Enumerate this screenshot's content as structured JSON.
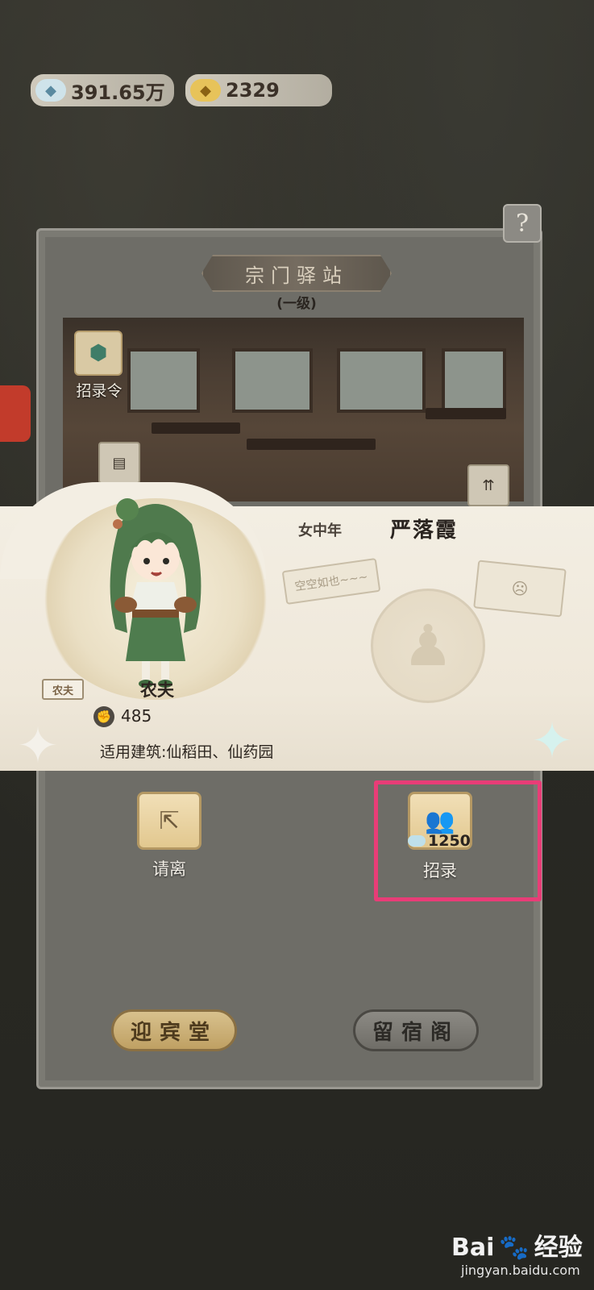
{
  "currency": {
    "silver_value": "391.65万",
    "silver_icon": "silver-ingot-icon",
    "gold_value": "2329",
    "gold_icon": "gold-ingot-icon"
  },
  "panel": {
    "help_label": "?",
    "title": "宗门驿站",
    "level": "(一级)",
    "recruit_token_label": "招录令"
  },
  "character": {
    "gender_age": "女中年",
    "name": "严落霞",
    "badge": "农夫",
    "role": "农夫",
    "power": "485",
    "buildings": "适用建筑:仙稻田、仙药园",
    "speech_bubble": "空空如也~~~"
  },
  "actions": {
    "dismiss_label": "请离",
    "recruit_label": "招录",
    "recruit_cost": "1250"
  },
  "bottom": {
    "guest_hall": "迎宾堂",
    "inn_pavilion": "留宿阁"
  },
  "watermark": {
    "brand": "Bai",
    "brand2": "经验",
    "url": "jingyan.baidu.com"
  },
  "colors": {
    "highlight": "#e83d77",
    "card_bg": "#f3eee3"
  }
}
